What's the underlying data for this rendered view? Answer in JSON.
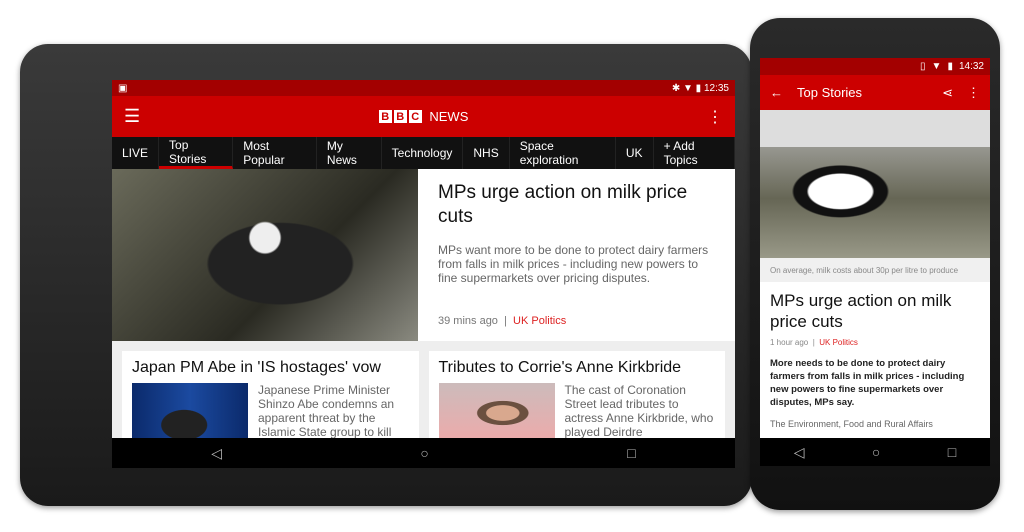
{
  "tablet": {
    "status": {
      "time": "12:35",
      "icons": [
        "image-icon",
        "bluetooth-icon",
        "wifi-icon",
        "battery-icon"
      ]
    },
    "app_title": "NEWS",
    "logo_letters": [
      "B",
      "B",
      "C"
    ],
    "tabs": [
      "LIVE",
      "Top Stories",
      "Most Popular",
      "My News",
      "Technology",
      "NHS",
      "Space exploration",
      "UK",
      "+ Add Topics"
    ],
    "active_tab": "Top Stories",
    "hero": {
      "title": "MPs urge action on milk price cuts",
      "summary": "MPs want more to be done to protect dairy farmers from falls in milk prices - including new powers to fine supermarkets over pricing disputes.",
      "time": "39 mins ago",
      "section": "UK Politics"
    },
    "cards": [
      {
        "title": "Japan PM Abe in 'IS hostages' vow",
        "summary": "Japanese Prime Minister Shinzo Abe condemns an apparent threat by the Islamic State group to kill"
      },
      {
        "title": "Tributes to Corrie's Anne Kirkbride",
        "summary": "The cast of Coronation Street lead tributes to actress Anne Kirkbride, who played Deirdre"
      }
    ]
  },
  "phone": {
    "status": {
      "time": "14:32"
    },
    "title": "Top Stories",
    "caption": "On average, milk costs about 30p per litre to produce",
    "headline": "MPs urge action on milk price cuts",
    "time": "1 hour ago",
    "section": "UK Politics",
    "body": "More needs to be done to protect dairy farmers from falls in milk prices - including new powers to fine supermarkets over disputes, MPs say.",
    "more": "The Environment, Food and Rural Affairs"
  },
  "colors": {
    "brand": "#cc0000",
    "status": "#a30000",
    "tabs_bg": "#111111"
  }
}
